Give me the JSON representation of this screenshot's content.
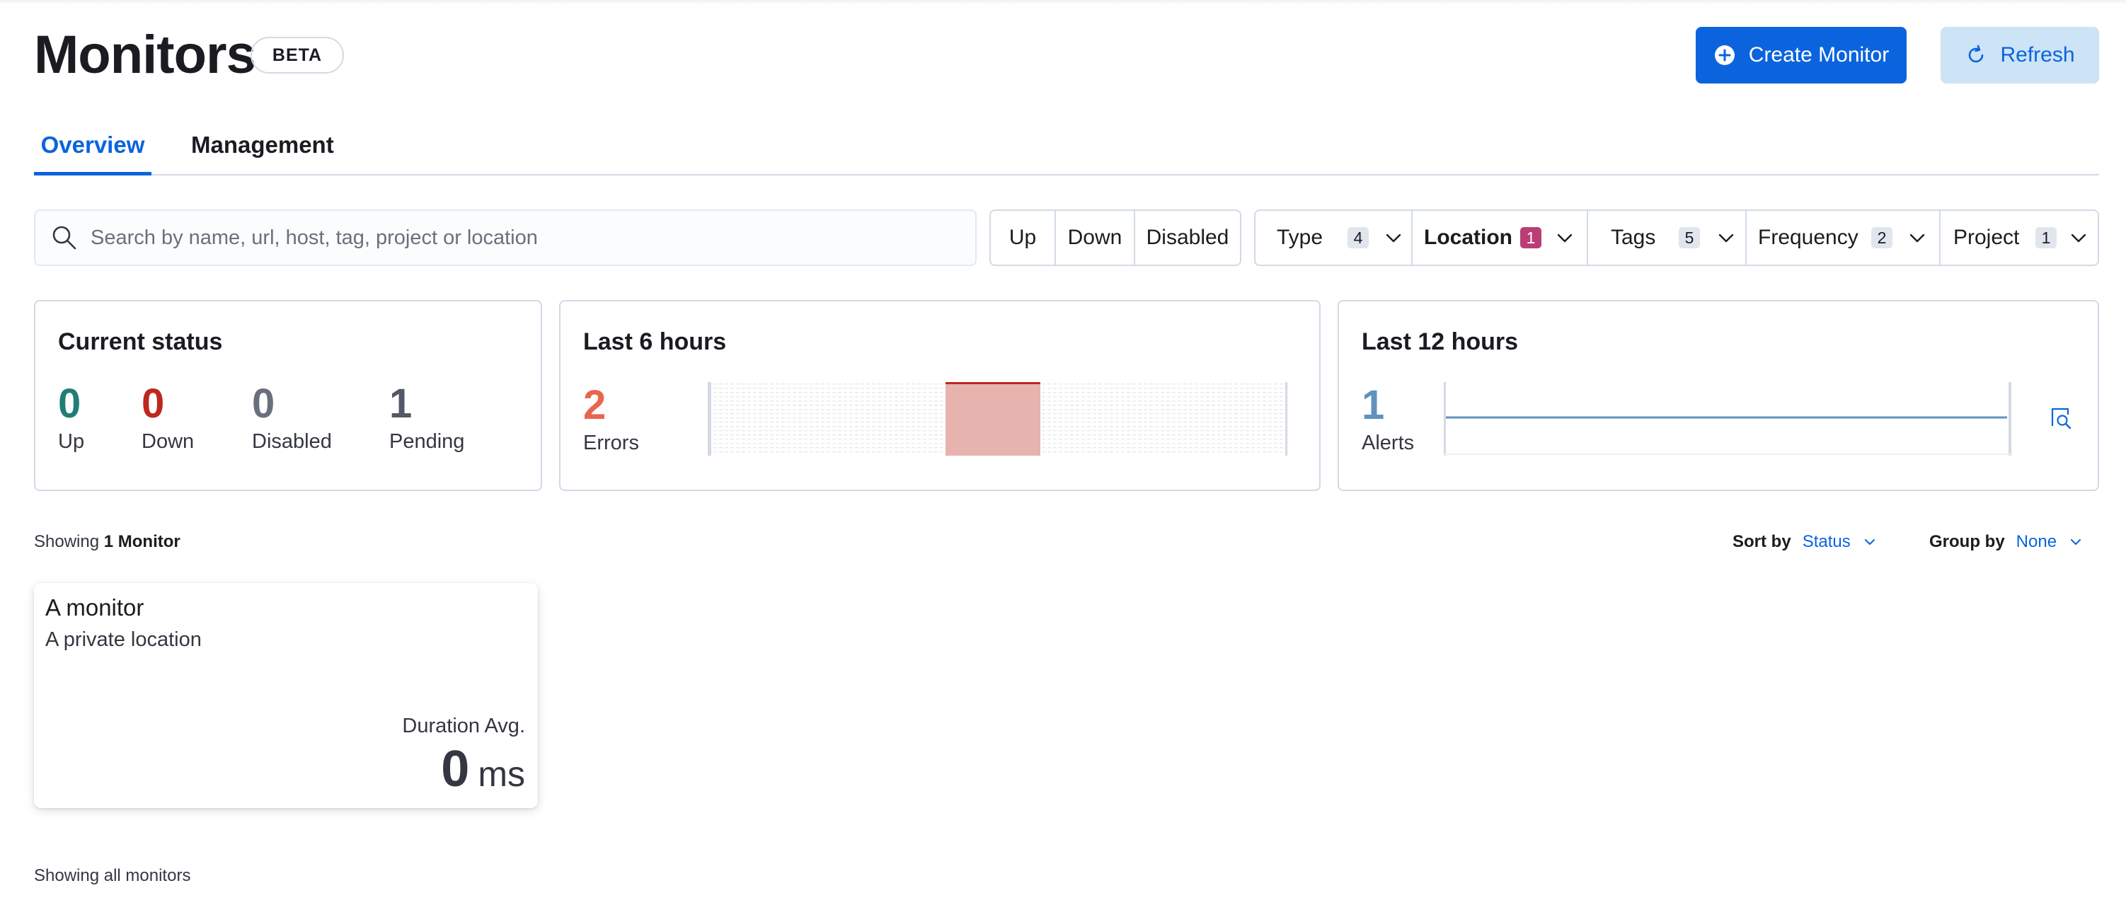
{
  "header": {
    "title": "Monitors",
    "badge": "BETA",
    "create_label": "Create Monitor",
    "refresh_label": "Refresh",
    "create_icon": "plus-circle-icon",
    "refresh_icon": "refresh-icon"
  },
  "tabs": [
    {
      "label": "Overview",
      "active": true
    },
    {
      "label": "Management",
      "active": false
    }
  ],
  "search": {
    "placeholder": "Search by name, url, host, tag, project or location",
    "value": ""
  },
  "status_filters": [
    "Up",
    "Down",
    "Disabled"
  ],
  "dropdown_filters": [
    {
      "label": "Type",
      "count": "4",
      "active": false
    },
    {
      "label": "Location",
      "count": "1",
      "active": true
    },
    {
      "label": "Tags",
      "count": "5",
      "active": false
    },
    {
      "label": "Frequency",
      "count": "2",
      "active": false
    },
    {
      "label": "Project",
      "count": "1",
      "active": false
    }
  ],
  "current_status": {
    "title": "Current status",
    "stats": [
      {
        "value": "0",
        "label": "Up",
        "color": "#207f75"
      },
      {
        "value": "0",
        "label": "Down",
        "color": "#bd271e"
      },
      {
        "value": "0",
        "label": "Disabled",
        "color": "#69707d"
      },
      {
        "value": "1",
        "label": "Pending",
        "color": "#535966"
      }
    ]
  },
  "last6": {
    "title": "Last 6 hours",
    "value": "2",
    "label": "Errors",
    "value_color": "#e7664c"
  },
  "last12": {
    "title": "Last 12 hours",
    "value": "1",
    "label": "Alerts",
    "value_color": "#6092c0",
    "inspect_icon": "inspect-icon"
  },
  "list": {
    "showing_prefix": "Showing",
    "showing_bold": "1 Monitor",
    "sort_label": "Sort by",
    "sort_value": "Status",
    "group_label": "Group by",
    "group_value": "None"
  },
  "monitor_card": {
    "name": "A monitor",
    "location": "A private location",
    "duration_label": "Duration Avg.",
    "duration_value": "0",
    "duration_unit": "ms"
  },
  "footer": {
    "text": "Showing all monitors"
  },
  "colors": {
    "accent": "#0b64dd",
    "error_bar": "#e7b3ae",
    "error_line": "#bd271e"
  }
}
